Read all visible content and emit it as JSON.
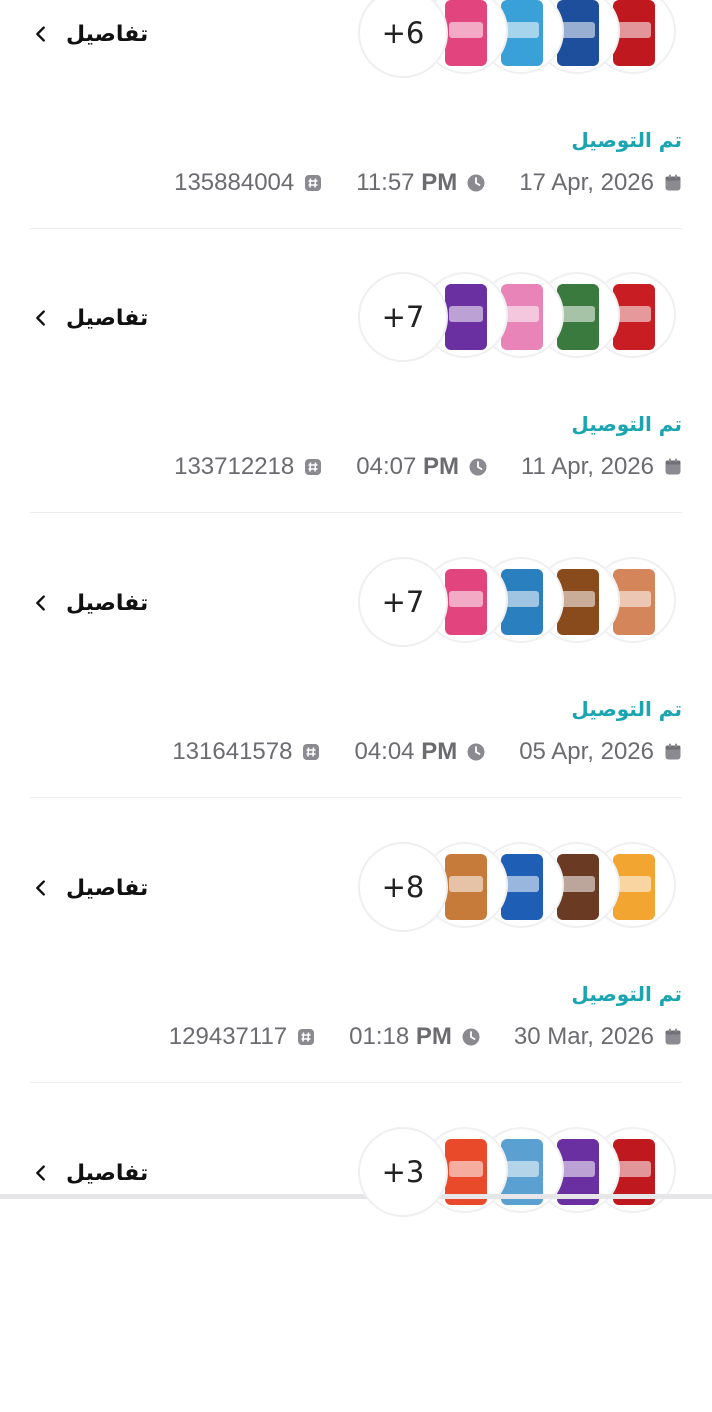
{
  "details_label": "تفاصيل",
  "status_label": "تم التوصيل",
  "icons": {
    "chevron": "chevron-left-icon",
    "calendar": "calendar-icon",
    "clock": "clock-icon",
    "hash": "hash-icon"
  },
  "colors": {
    "status": "#1aa5b0",
    "text_secondary": "#6b6b70",
    "details": "#111111"
  },
  "orders": [
    {
      "more_count": "+6",
      "status": "تم التوصيل",
      "date": "17 Apr, 2026",
      "time": "11:57",
      "ampm": "PM",
      "order_id": "135884004",
      "products": [
        {
          "name": "red-can",
          "color": "#c0181f"
        },
        {
          "name": "blue-can",
          "color": "#1d4f9c"
        },
        {
          "name": "chips-bag",
          "color": "#3aa0d8"
        },
        {
          "name": "pink-can",
          "color": "#e2447e"
        }
      ]
    },
    {
      "more_count": "+7",
      "status": "تم التوصيل",
      "date": "11 Apr, 2026",
      "time": "04:07",
      "ampm": "PM",
      "order_id": "133712218",
      "products": [
        {
          "name": "red-can",
          "color": "#c81e23"
        },
        {
          "name": "small-item",
          "color": "#3b7a3f"
        },
        {
          "name": "pink-can",
          "color": "#e884b8"
        },
        {
          "name": "purple-chips",
          "color": "#6a2fa0"
        }
      ]
    },
    {
      "more_count": "+7",
      "status": "تم التوصيل",
      "date": "05 Apr, 2026",
      "time": "04:04",
      "ampm": "PM",
      "order_id": "131641578",
      "products": [
        {
          "name": "snack-bag",
          "color": "#d4865a"
        },
        {
          "name": "bottle",
          "color": "#8a4b1c"
        },
        {
          "name": "blue-pack",
          "color": "#2a7fbf"
        },
        {
          "name": "pink-can",
          "color": "#e2447e"
        }
      ]
    },
    {
      "more_count": "+8",
      "status": "تم التوصيل",
      "date": "30 Mar, 2026",
      "time": "01:18",
      "ampm": "PM",
      "order_id": "129437117",
      "products": [
        {
          "name": "orange-chips",
          "color": "#f2a530"
        },
        {
          "name": "barni-pack",
          "color": "#6a3a22"
        },
        {
          "name": "tasali-chips",
          "color": "#1e5fb5"
        },
        {
          "name": "bread-bag",
          "color": "#c77b3b"
        }
      ]
    },
    {
      "more_count": "+3",
      "status": "",
      "date": "",
      "time": "",
      "ampm": "",
      "order_id": "",
      "products": [
        {
          "name": "red-can",
          "color": "#c0181f"
        },
        {
          "name": "purple-chips",
          "color": "#6a2fa0"
        },
        {
          "name": "marami-pack",
          "color": "#5aa0d0"
        },
        {
          "name": "tasali-chips",
          "color": "#e84a2a"
        }
      ]
    }
  ]
}
